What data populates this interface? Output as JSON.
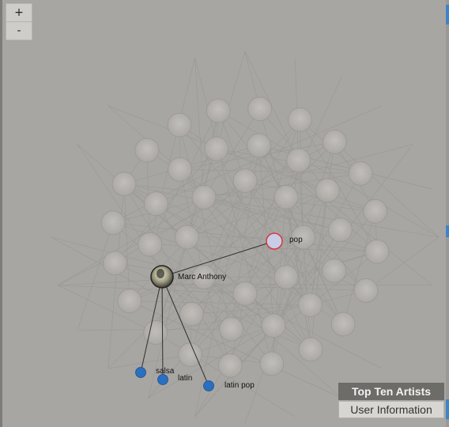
{
  "zoom": {
    "in_label": "+",
    "out_label": "-"
  },
  "graph": {
    "selected_artist": "Marc Anthony",
    "genres": [
      {
        "label": "pop",
        "color": "#c8cde6",
        "stroke": "#d9363e"
      },
      {
        "label": "salsa",
        "color": "#2a6fc0"
      },
      {
        "label": "latin",
        "color": "#2a6fc0"
      },
      {
        "label": "latin pop",
        "color": "#2a6fc0"
      }
    ]
  },
  "panel": {
    "top_ten_label": "Top Ten Artists",
    "user_info_label": "User Information"
  }
}
